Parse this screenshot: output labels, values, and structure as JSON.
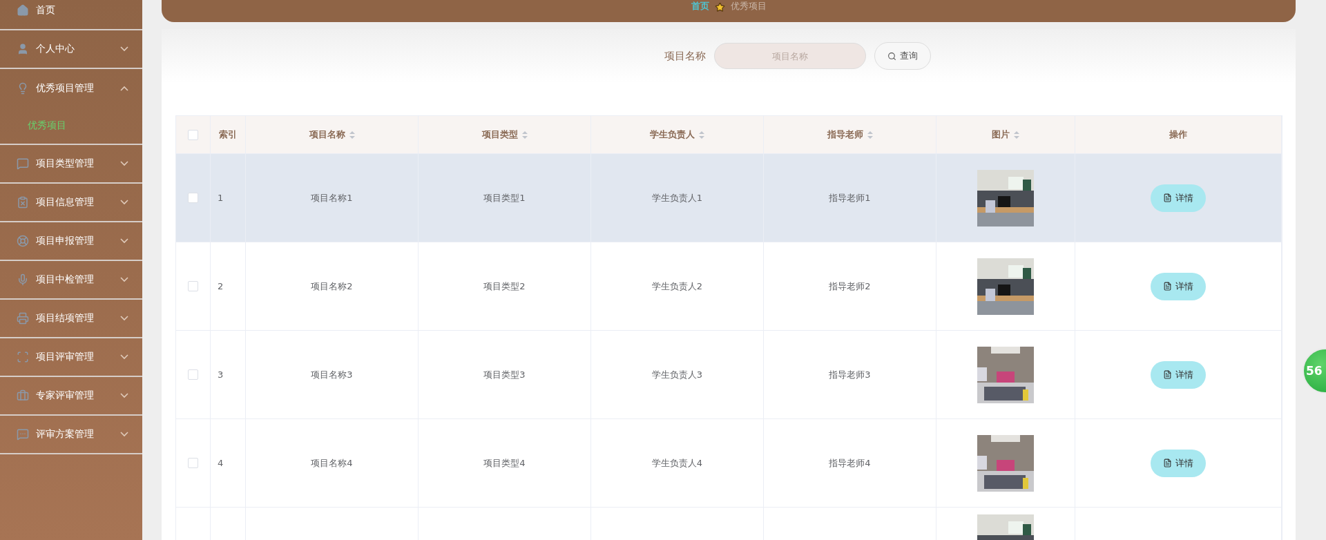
{
  "sidebar": {
    "items": [
      {
        "label": "首页"
      },
      {
        "label": "个人中心",
        "expanded": false
      },
      {
        "label": "优秀项目管理",
        "expanded": true,
        "children": [
          {
            "label": "优秀项目",
            "selected": true
          }
        ]
      },
      {
        "label": "项目类型管理",
        "expanded": false
      },
      {
        "label": "项目信息管理",
        "expanded": false
      },
      {
        "label": "项目申报管理",
        "expanded": false
      },
      {
        "label": "项目中检管理",
        "expanded": false
      },
      {
        "label": "项目结项管理",
        "expanded": false
      },
      {
        "label": "项目评审管理",
        "expanded": false
      },
      {
        "label": "专家评审管理",
        "expanded": false
      },
      {
        "label": "评审方案管理",
        "expanded": false
      }
    ]
  },
  "breadcrumb": [
    "首页",
    "优秀项目"
  ],
  "search": {
    "label": "项目名称",
    "placeholder": "项目名称",
    "button": "查询"
  },
  "table": {
    "columns": [
      {
        "label": "索引",
        "sortable": false
      },
      {
        "label": "项目名称",
        "sortable": true
      },
      {
        "label": "项目类型",
        "sortable": true
      },
      {
        "label": "学生负责人",
        "sortable": true
      },
      {
        "label": "指导老师",
        "sortable": true
      },
      {
        "label": "图片",
        "sortable": true
      },
      {
        "label": "操作",
        "sortable": false
      }
    ],
    "select_all_checked": false,
    "rows": [
      {
        "checked": false,
        "highlighted": true,
        "cells": [
          "1",
          "项目名称1",
          "项目类型1",
          "学生负责人1",
          "指导老师1"
        ],
        "action": "详情"
      },
      {
        "checked": false,
        "highlighted": false,
        "cells": [
          "2",
          "项目名称2",
          "项目类型2",
          "学生负责人2",
          "指导老师2"
        ],
        "action": "详情"
      },
      {
        "checked": false,
        "highlighted": false,
        "cells": [
          "3",
          "项目名称3",
          "项目类型3",
          "学生负责人3",
          "指导老师3"
        ],
        "action": "详情"
      },
      {
        "checked": false,
        "highlighted": false,
        "cells": [
          "4",
          "项目名称4",
          "项目类型4",
          "学生负责人4",
          "指导老师4"
        ],
        "action": "详情"
      }
    ]
  },
  "floating_badge": "56"
}
